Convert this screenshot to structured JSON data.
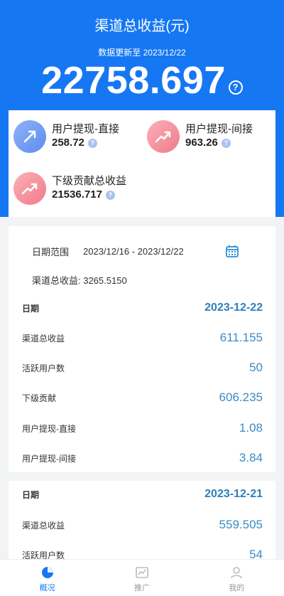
{
  "hero": {
    "title": "渠道总收益(元)",
    "update_text": "数据更新至 2023/12/22",
    "total": "22758.697"
  },
  "stats": {
    "direct": {
      "label": "用户提现-直接",
      "value": "258.72"
    },
    "indirect": {
      "label": "用户提现-间接",
      "value": "963.26"
    },
    "sub": {
      "label": "下级贡献总收益",
      "value": "21536.717"
    }
  },
  "summary": {
    "range_label": "日期范围",
    "range_value": "2023/12/16 - 2023/12/22",
    "total_text": "渠道总收益: 3265.5150"
  },
  "days": [
    {
      "date_label": "日期",
      "date": "2023-12-22",
      "rows": [
        {
          "k": "渠道总收益",
          "v": "611.155"
        },
        {
          "k": "活跃用户数",
          "v": "50"
        },
        {
          "k": "下级贡献",
          "v": "606.235"
        },
        {
          "k": "用户提现-直接",
          "v": "1.08"
        },
        {
          "k": "用户提现-间接",
          "v": "3.84"
        }
      ]
    },
    {
      "date_label": "日期",
      "date": "2023-12-21",
      "rows": [
        {
          "k": "渠道总收益",
          "v": "559.505"
        },
        {
          "k": "活跃用户数",
          "v": "54"
        }
      ]
    }
  ],
  "tabs": [
    {
      "label": "概况",
      "icon": "overview-icon"
    },
    {
      "label": "推广",
      "icon": "chart-icon"
    },
    {
      "label": "我的",
      "icon": "user-icon"
    }
  ],
  "colors": {
    "primary": "#1677f3",
    "value_blue": "#3b8bc6"
  }
}
